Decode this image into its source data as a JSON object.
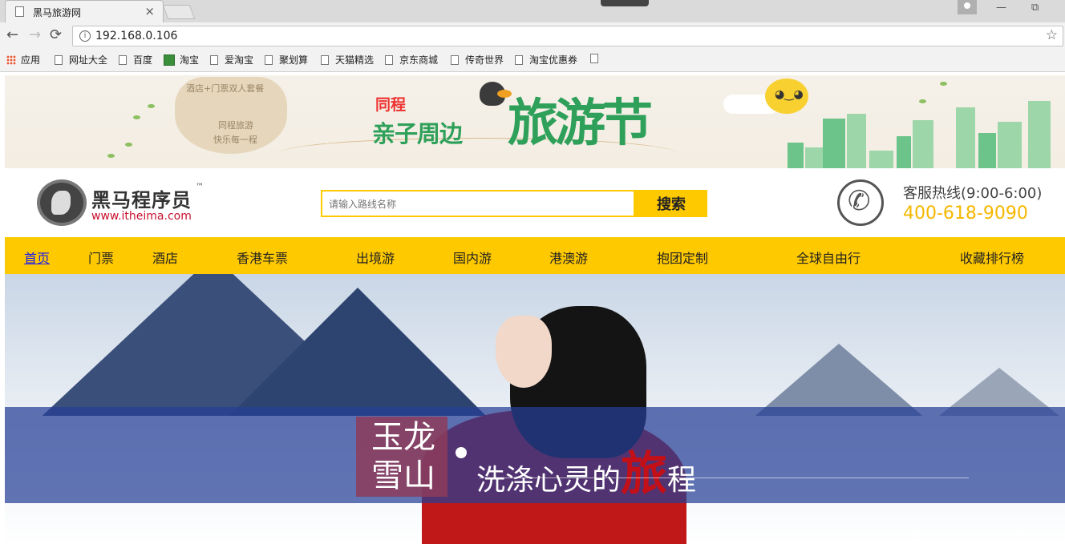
{
  "browser": {
    "tab_title": "黑马旅游网",
    "tab_close": "×",
    "url": "192.168.0.106",
    "back": "←",
    "forward": "→",
    "reload": "⟳",
    "info": "i",
    "bookmark_star": "☆",
    "win_minimize": "—",
    "win_restore": "⧉",
    "bookmarks": [
      "应用",
      "网址大全",
      "百度",
      "淘宝",
      "爱淘宝",
      "聚划算",
      "天猫精选",
      "京东商城",
      "传奇世界",
      "淘宝优惠券",
      ""
    ]
  },
  "promo": {
    "cloud_lines": [
      "酒店+门票双人套餐",
      "同程旅游",
      "快乐每一程"
    ],
    "brand_small": "同程",
    "slogan_small": "亲子周边",
    "slogan_big": "旅游节"
  },
  "header": {
    "brand": "黑马程序员",
    "tm": "™",
    "brand_url": "www.itheima.com",
    "search_placeholder": "请输入路线名称",
    "search_button": "搜索",
    "hotline_label": "客服热线(9:00-6:00)",
    "hotline_number": "400-618-9090",
    "phone_glyph": "✆"
  },
  "nav": {
    "items": [
      "首页",
      "门票",
      "酒店",
      "香港车票",
      "出境游",
      "国内游",
      "港澳游",
      "抱团定制",
      "全球自由行",
      "收藏排行榜"
    ]
  },
  "hero": {
    "seal_line1": "玉龙",
    "seal_line2": "雪山",
    "slogan_pre": "洗涤心灵的",
    "slogan_emph": "旅",
    "slogan_post": "程"
  },
  "colors": {
    "accent": "#ffc900",
    "brand_red": "#c8102e",
    "phone": "#f5b800"
  }
}
